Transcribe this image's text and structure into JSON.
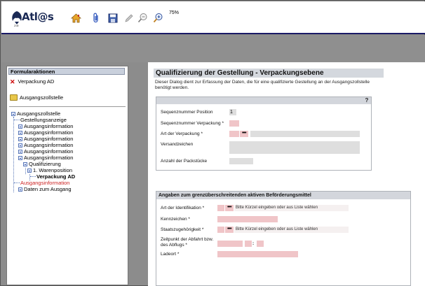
{
  "toolbar": {
    "logo_text": "Atl@s",
    "logo_sub": "Zoll",
    "zoom": "75%",
    "icons": [
      "home-icon",
      "paperclip-icon",
      "save-icon",
      "pencil-icon",
      "zoom-out-icon",
      "zoom-in-icon"
    ]
  },
  "left": {
    "header": "Formularaktionen",
    "action": "Verpackung AD",
    "ausgang": "Ausgangszollstelle",
    "tree": [
      {
        "label": "Ausgangszollstelle",
        "level": 0,
        "type": "box"
      },
      {
        "label": "Gestellungsanzeige",
        "level": 1,
        "type": "dash"
      },
      {
        "label": "Ausgangsinformation",
        "level": 1,
        "type": "box"
      },
      {
        "label": "Ausgangsinformation",
        "level": 1,
        "type": "box"
      },
      {
        "label": "Ausgangsinformation",
        "level": 1,
        "type": "box"
      },
      {
        "label": "Ausgangsinformation",
        "level": 1,
        "type": "box"
      },
      {
        "label": "Ausgangsinformation",
        "level": 1,
        "type": "box"
      },
      {
        "label": "Ausgangsinformation",
        "level": 1,
        "type": "box"
      },
      {
        "label": "Qualifizierung",
        "level": 2,
        "type": "box"
      },
      {
        "label": "1. Warenposition",
        "level": 3,
        "type": "box"
      },
      {
        "label": "Verpackung AD",
        "level": 4,
        "type": "dash",
        "bold": true
      },
      {
        "label": "Ausgangsinformation",
        "level": 1,
        "type": "dash",
        "red": true
      },
      {
        "label": "Daten zum Ausgang",
        "level": 1,
        "type": "box"
      }
    ]
  },
  "main": {
    "title": "Qualifizierung der Gestellung - Verpackungsebene",
    "description": "Dieser Dialog dient zur Erfassung der Daten, die für eine qualifizierte Gestellung an der Ausgangszollstelle benötigt werden.",
    "help": "?",
    "sec1": {
      "pos_label": "Sequenznummer Position",
      "pos_value": "1",
      "verp_label": "Sequenznummer Verpackung *",
      "art_label": "Art der Verpackung *",
      "versand_label": "Versandzeichen",
      "anzahl_label": "Anzahl der Packstücke",
      "dots": "•••"
    },
    "sec2": {
      "header": "Angaben zum grenzüberschreitenden aktiven Beförderungsmittel",
      "ident_label": "Art der Identifikation *",
      "hint": "Bitte Kürzel eingeben oder aus Liste wählen",
      "kenn_label": "Kennzeichen *",
      "staat_label": "Staatszugehörigkeit *",
      "abfahrt_label": "Zeitpunkt der Abfahrt bzw. des Abflugs *",
      "colon": ":",
      "ladeort_label": "Ladeort *",
      "dots": "•••"
    }
  }
}
